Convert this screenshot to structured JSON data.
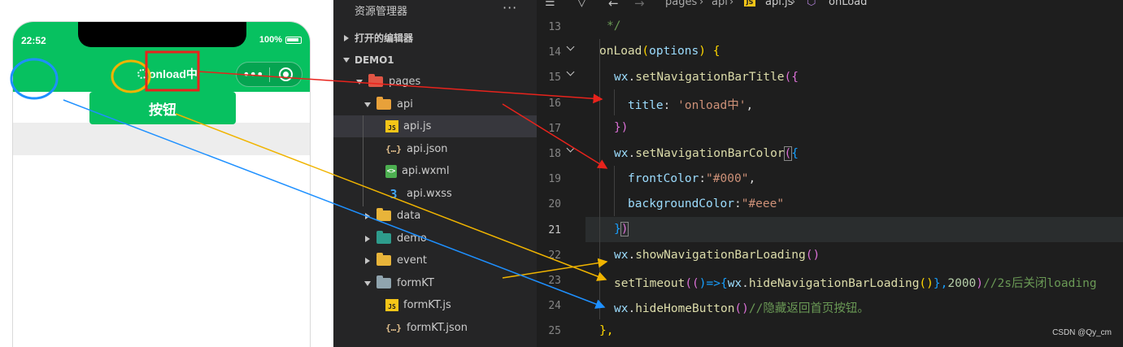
{
  "simulator": {
    "time": "22:52",
    "battery": "100%",
    "nav_title": "onload中",
    "button_label": "按钮",
    "capsule_more": "•••"
  },
  "explorer": {
    "title": "资源管理器",
    "more": "···",
    "open_editors": "打开的编辑器",
    "project": "DEMO1",
    "items": [
      {
        "label": "pages",
        "kind": "folder",
        "color": "#e05545",
        "expanded": true,
        "twisty": "down"
      },
      {
        "label": "api",
        "kind": "folder",
        "color": "#e8a13a",
        "expanded": true,
        "twisty": "down"
      },
      {
        "label": "api.js",
        "kind": "js",
        "selected": true
      },
      {
        "label": "api.json",
        "kind": "json"
      },
      {
        "label": "api.wxml",
        "kind": "wxml"
      },
      {
        "label": "api.wxss",
        "kind": "wxss"
      },
      {
        "label": "data",
        "kind": "folder",
        "color": "#e8b43a",
        "twisty": "right"
      },
      {
        "label": "demo",
        "kind": "folder",
        "color": "#2e9c8c",
        "twisty": "right"
      },
      {
        "label": "event",
        "kind": "folder",
        "color": "#e8b43a",
        "twisty": "right"
      },
      {
        "label": "formKT",
        "kind": "folder",
        "color": "#90a4ae",
        "twisty": "down"
      },
      {
        "label": "formKT.js",
        "kind": "js"
      },
      {
        "label": "formKT.json",
        "kind": "json"
      }
    ]
  },
  "editor": {
    "breadcrumb": [
      "pages",
      "api",
      "api.js",
      "onLoad"
    ],
    "line_numbers": [
      "13",
      "14",
      "15",
      "16",
      "17",
      "18",
      "19",
      "20",
      "21",
      "22",
      "23",
      "24",
      "25"
    ],
    "current_line": "21"
  },
  "code": {
    "l13_comment": "*/",
    "l14_onload": "onLoad",
    "l14_paren_open": "(",
    "l14_options": "options",
    "l14_paren_close": ")",
    "l14_brace": " {",
    "wx": "wx",
    "dot": ".",
    "l15_fn": "setNavigationBarTitle",
    "l15_open": "({",
    "l16_key": "title",
    "colon_space": ": ",
    "l16_val": "'onload中'",
    "comma": ",",
    "close_obj": "})",
    "l18_fn": "setNavigationBarColor",
    "l19_key": "frontColor",
    "colon": ":",
    "l19_val": "\"#000\"",
    "l20_key": "backgroundColor",
    "l20_val": "\"#eee\"",
    "l22_fn": "showNavigationBarLoading",
    "empty_call": "()",
    "l23_fn": "setTimeout",
    "l23_a": "((",
    "l23_b": ")=>{",
    "l23_inner_fn": "hideNavigationBarLoading",
    "l23_c": "()",
    "l23_d": "},",
    "l23_num": "2000",
    "l23_e": ")",
    "l23_comment": "//2s后关闭loading",
    "l24_fn": "hideHomeButton",
    "l24_comment": "//隐藏返回首页按钮。",
    "l25": "},"
  },
  "watermark": "CSDN @Qy_cm",
  "colors": {
    "wechat_green": "#07c160",
    "annot_red": "#e8231c",
    "annot_orange": "#f0b400",
    "annot_blue": "#1e90ff"
  }
}
